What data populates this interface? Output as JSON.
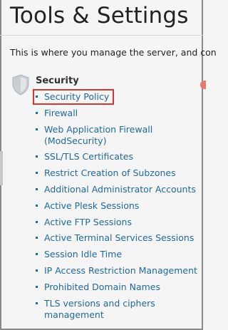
{
  "page": {
    "title": "Tools & Settings",
    "intro": "This is where you manage the server, and con"
  },
  "section": {
    "icon": "shield-icon",
    "title": "Security"
  },
  "links": [
    {
      "label": "Security Policy",
      "highlighted": true
    },
    {
      "label": "Firewall"
    },
    {
      "label": "Web Application Firewall (ModSecurity)"
    },
    {
      "label": "SSL/TLS Certificates"
    },
    {
      "label": "Restrict Creation of Subzones"
    },
    {
      "label": "Additional Administrator Accounts"
    },
    {
      "label": "Active Plesk Sessions"
    },
    {
      "label": "Active FTP Sessions"
    },
    {
      "label": "Active Terminal Services Sessions"
    },
    {
      "label": "Session Idle Time"
    },
    {
      "label": "IP Access Restriction Management"
    },
    {
      "label": "Prohibited Domain Names"
    },
    {
      "label": "TLS versions and ciphers management"
    }
  ],
  "colors": {
    "link": "#1e6a9c",
    "highlight_border": "#d9342b",
    "background": "#f5f5f5"
  }
}
